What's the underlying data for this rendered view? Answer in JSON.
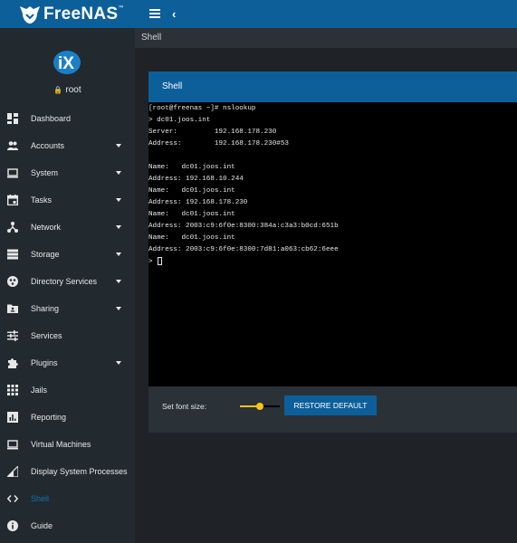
{
  "brand": {
    "name": "FreeNAS",
    "trademark": "™",
    "sub_logo": "iX"
  },
  "user": {
    "name": "root"
  },
  "sidebar": {
    "items": [
      {
        "label": "Dashboard",
        "icon": "dashboard-icon",
        "expandable": false
      },
      {
        "label": "Accounts",
        "icon": "people-icon",
        "expandable": true
      },
      {
        "label": "System",
        "icon": "laptop-icon",
        "expandable": true
      },
      {
        "label": "Tasks",
        "icon": "calendar-icon",
        "expandable": true
      },
      {
        "label": "Network",
        "icon": "network-icon",
        "expandable": true
      },
      {
        "label": "Storage",
        "icon": "storage-icon",
        "expandable": true
      },
      {
        "label": "Directory Services",
        "icon": "directory-icon",
        "expandable": true
      },
      {
        "label": "Sharing",
        "icon": "share-folder-icon",
        "expandable": true
      },
      {
        "label": "Services",
        "icon": "tune-icon",
        "expandable": false
      },
      {
        "label": "Plugins",
        "icon": "puzzle-icon",
        "expandable": true
      },
      {
        "label": "Jails",
        "icon": "grid-icon",
        "expandable": false
      },
      {
        "label": "Reporting",
        "icon": "chart-icon",
        "expandable": false
      },
      {
        "label": "Virtual Machines",
        "icon": "computer-icon",
        "expandable": false
      },
      {
        "label": "Display System Processes",
        "icon": "signal-icon",
        "expandable": false
      },
      {
        "label": "Shell",
        "icon": "code-icon",
        "expandable": false,
        "active": true
      },
      {
        "label": "Guide",
        "icon": "info-icon",
        "expandable": false
      }
    ]
  },
  "page": {
    "title": "Shell"
  },
  "card": {
    "title": "Shell"
  },
  "terminal": {
    "lines": [
      "[root@freenas ~]# nslookup",
      "> dc01.joos.int",
      "Server:         192.168.178.230",
      "Address:        192.168.178.230#53",
      "",
      "Name:   dc01.joos.int",
      "Address: 192.168.10.244",
      "Name:   dc01.joos.int",
      "Address: 192.168.178.230",
      "Name:   dc01.joos.int",
      "Address: 2003:c9:6f0e:8300:384a:c3a3:b0cd:651b",
      "Name:   dc01.joos.int",
      "Address: 2003:c9:6f0e:8300:7d81:a063:cb62:6eee"
    ],
    "prompt": "> "
  },
  "font_control": {
    "label": "Set font size:",
    "slider_fraction": 0.5,
    "restore_label": "RESTORE DEFAULT"
  },
  "colors": {
    "topbar": "#0d5f9a",
    "sidebar": "#222a30",
    "content_bg": "#1f2327",
    "card_bg": "#2a3137",
    "active_nav": "#0d73b8",
    "slider_accent": "#f5c518",
    "terminal_bg": "#000000"
  }
}
